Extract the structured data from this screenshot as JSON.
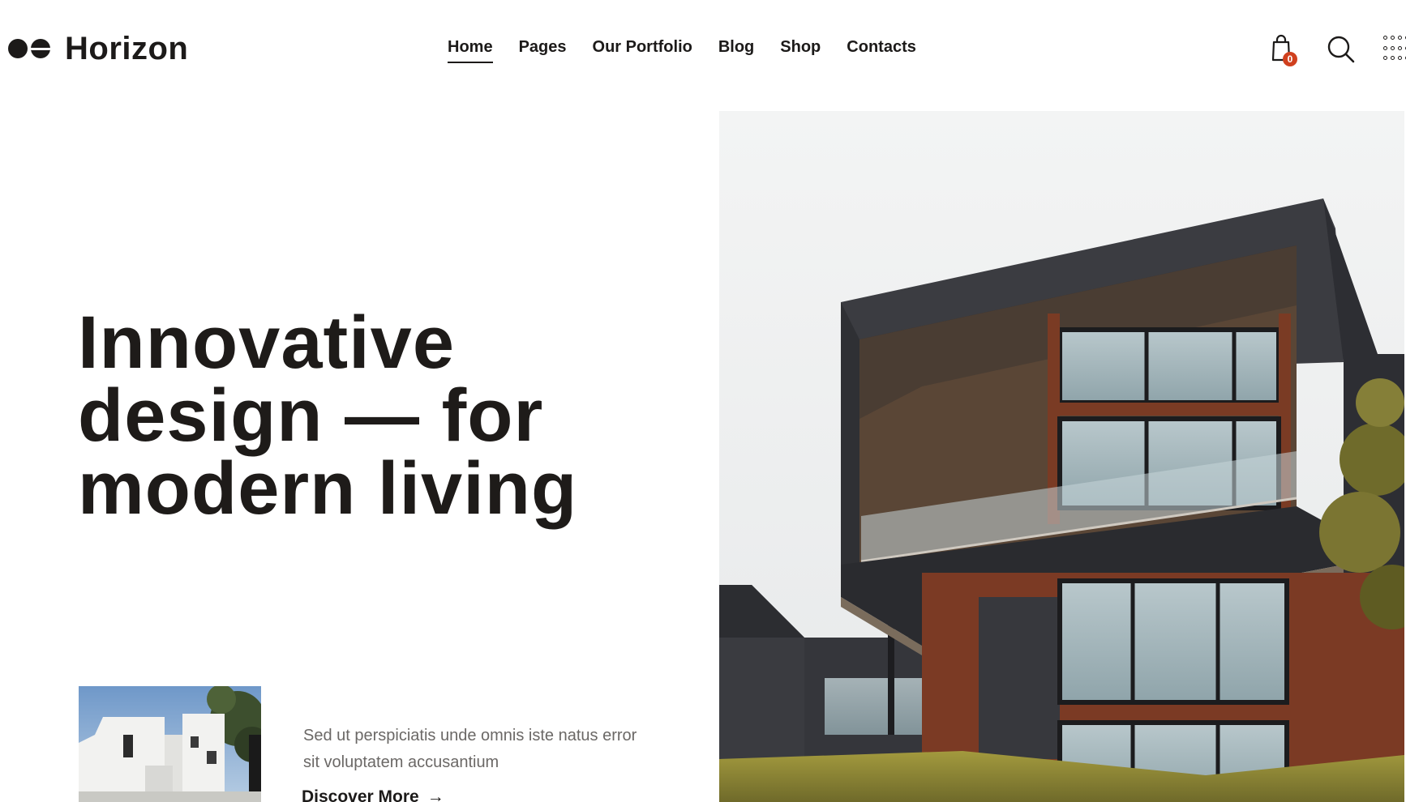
{
  "header": {
    "logo_text": "Horizon",
    "nav": [
      {
        "label": "Home",
        "active": true
      },
      {
        "label": "Pages",
        "active": false
      },
      {
        "label": "Our Portfolio",
        "active": false
      },
      {
        "label": "Blog",
        "active": false
      },
      {
        "label": "Shop",
        "active": false
      },
      {
        "label": "Contacts",
        "active": false
      }
    ],
    "cart_count": "0",
    "icons": [
      "cart-icon",
      "search-icon",
      "grid-menu-icon"
    ]
  },
  "hero": {
    "title_lines": [
      "Innovative",
      "design — for",
      "modern living"
    ],
    "description": "Sed ut perspiciatis unde omnis iste natus error sit voluptatem accusantium",
    "cta_label": "Discover More",
    "cta_icon": "arrow-right-icon"
  },
  "colors": {
    "text": "#1c1a19",
    "muted_text": "#6b6866",
    "badge": "#d0401e",
    "background": "#ffffff"
  }
}
